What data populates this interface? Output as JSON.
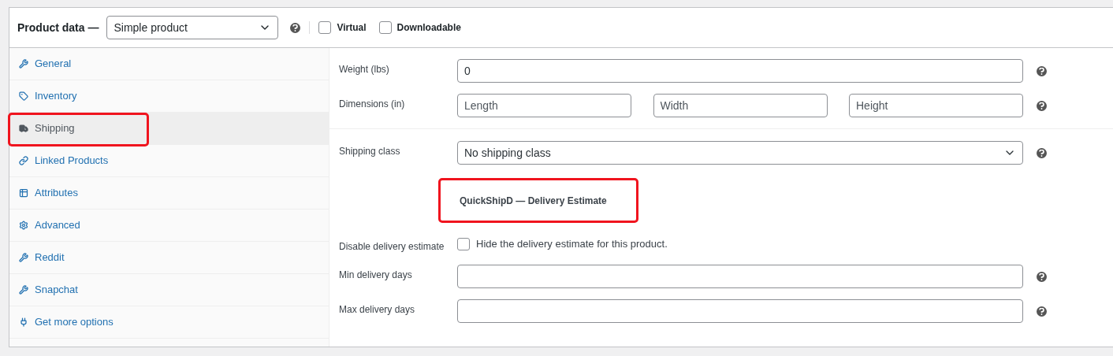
{
  "header": {
    "title": "Product data —",
    "product_type": "Simple product",
    "options": [
      {
        "label": "Virtual",
        "checked": false
      },
      {
        "label": "Downloadable",
        "checked": false
      }
    ]
  },
  "tabs": [
    {
      "label": "General",
      "selected": false,
      "highlighted": false
    },
    {
      "label": "Inventory",
      "selected": false,
      "highlighted": false
    },
    {
      "label": "Shipping",
      "selected": true,
      "highlighted": true
    },
    {
      "label": "Linked Products",
      "selected": false,
      "highlighted": false
    },
    {
      "label": "Attributes",
      "selected": false,
      "highlighted": false
    },
    {
      "label": "Advanced",
      "selected": false,
      "highlighted": false
    },
    {
      "label": "Reddit",
      "selected": false,
      "highlighted": false
    },
    {
      "label": "Snapchat",
      "selected": false,
      "highlighted": false
    },
    {
      "label": "Get more options",
      "selected": false,
      "highlighted": false
    }
  ],
  "weight": {
    "label": "Weight (lbs)",
    "value": "0"
  },
  "dimensions": {
    "label": "Dimensions (in)",
    "placeholders": [
      "Length",
      "Width",
      "Height"
    ]
  },
  "shipping_class": {
    "label": "Shipping class",
    "value": "No shipping class"
  },
  "section_heading": {
    "text": "QuickShipD — Delivery Estimate",
    "highlighted": true
  },
  "disable_estimate": {
    "label": "Disable delivery estimate",
    "description": "Hide the delivery estimate for this product.",
    "checked": false
  },
  "day_fields": [
    {
      "label": "Min delivery days"
    },
    {
      "label": "Max delivery days"
    }
  ]
}
